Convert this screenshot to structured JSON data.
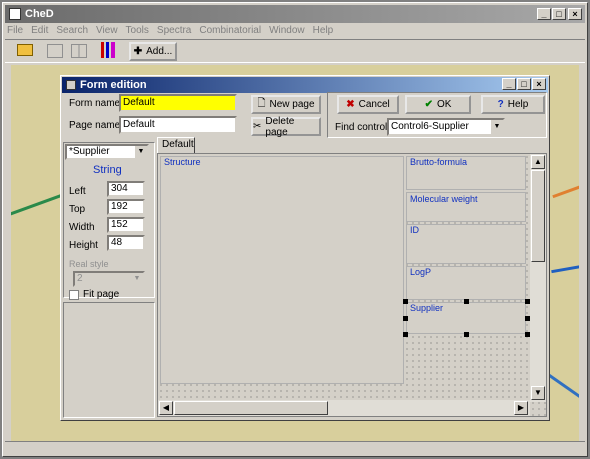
{
  "app": {
    "title": "CheD",
    "menu": [
      "File",
      "Edit",
      "Search",
      "View",
      "Tools",
      "Spectra",
      "Combinatorial",
      "Window",
      "Help"
    ],
    "add_label": "Add..."
  },
  "dialog": {
    "title": "Form edition",
    "form_name_label": "Form name",
    "form_name_value": "Default",
    "page_name_label": "Page name",
    "page_name_value": "Default",
    "new_page": "New page",
    "delete_page": "Delete page",
    "cancel": "Cancel",
    "ok": "OK",
    "help": "Help",
    "find_control_label": "Find control",
    "find_control_value": "Control6-Supplier"
  },
  "props": {
    "selected": "*Supplier",
    "type": "String",
    "left_label": "Left",
    "left": "304",
    "top_label": "Top",
    "top": "192",
    "width_label": "Width",
    "width": "152",
    "height_label": "Height",
    "height": "48",
    "real_style_label": "Real style",
    "real_style_value": "2",
    "fit_page": "Fit page"
  },
  "canvas": {
    "tab": "Default",
    "fields": [
      "Structure",
      "Brutto-formula",
      "Molecular weight",
      "ID",
      "LogP",
      "Supplier"
    ]
  },
  "colors": {
    "title_active": "#0a246a",
    "highlight": "#ffff00",
    "caption": "#1030c0",
    "cancel_icon": "#c00000",
    "ok_icon": "#008000"
  }
}
